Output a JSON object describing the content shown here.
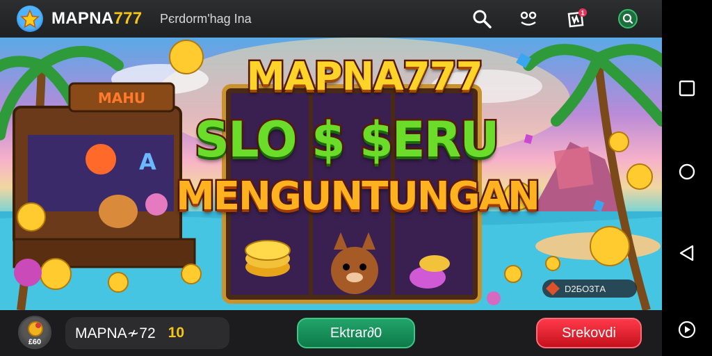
{
  "header": {
    "brand_main": "MAPNA",
    "brand_num": "777",
    "subtitle": "Pєrdorm'hag Ina",
    "icons": [
      "search-icon",
      "gamepad-icon",
      "notification-icon",
      "profile-search-icon"
    ],
    "notification_count": "1"
  },
  "hero": {
    "title_line1": "MAPNA777",
    "title_line2": "SLO $ $ERU",
    "title_line3": "MENGUNTUNGAN",
    "machine_sign": "MAHU",
    "badge_text": "D2БO3ТA"
  },
  "footer": {
    "avatar_label": "£60",
    "player_name": "MAPNA≁72",
    "player_level": "10",
    "primary_button": "Ektrar∂0",
    "secondary_button": "Srekovdi"
  },
  "navbar": {
    "icons": [
      "recents-icon",
      "home-icon",
      "back-icon",
      "play-icon"
    ]
  },
  "colors": {
    "accent_gold": "#f5c518",
    "button_green": "#0e7a4a",
    "button_red": "#c5101c"
  }
}
